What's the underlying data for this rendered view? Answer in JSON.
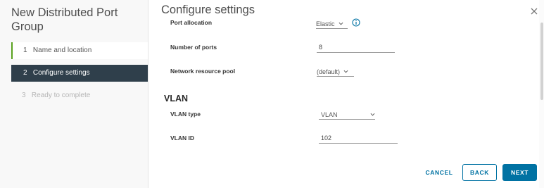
{
  "wizard": {
    "title": "New Distributed Port Group",
    "steps": [
      {
        "number": "1",
        "label": "Name and location",
        "state": "completed"
      },
      {
        "number": "2",
        "label": "Configure settings",
        "state": "active"
      },
      {
        "number": "3",
        "label": "Ready to complete",
        "state": "disabled"
      }
    ]
  },
  "main": {
    "title": "Configure settings",
    "port_allocation": {
      "label": "Port allocation",
      "value": "Elastic"
    },
    "number_of_ports": {
      "label": "Number of ports",
      "value": "8"
    },
    "network_resource_pool": {
      "label": "Network resource pool",
      "value": "(default)"
    },
    "vlan_section": "VLAN",
    "vlan_type": {
      "label": "VLAN type",
      "value": "VLAN"
    },
    "vlan_id": {
      "label": "VLAN ID",
      "value": "102"
    }
  },
  "footer": {
    "cancel": "CANCEL",
    "back": "BACK",
    "next": "NEXT"
  },
  "icons": {
    "close": "close-icon",
    "info": "info-icon",
    "chevron": "chevron-down-icon"
  },
  "colors": {
    "accent": "#0072a3",
    "active_step_bg": "#2f3f4b",
    "completed_step_marker": "#5aa220"
  }
}
